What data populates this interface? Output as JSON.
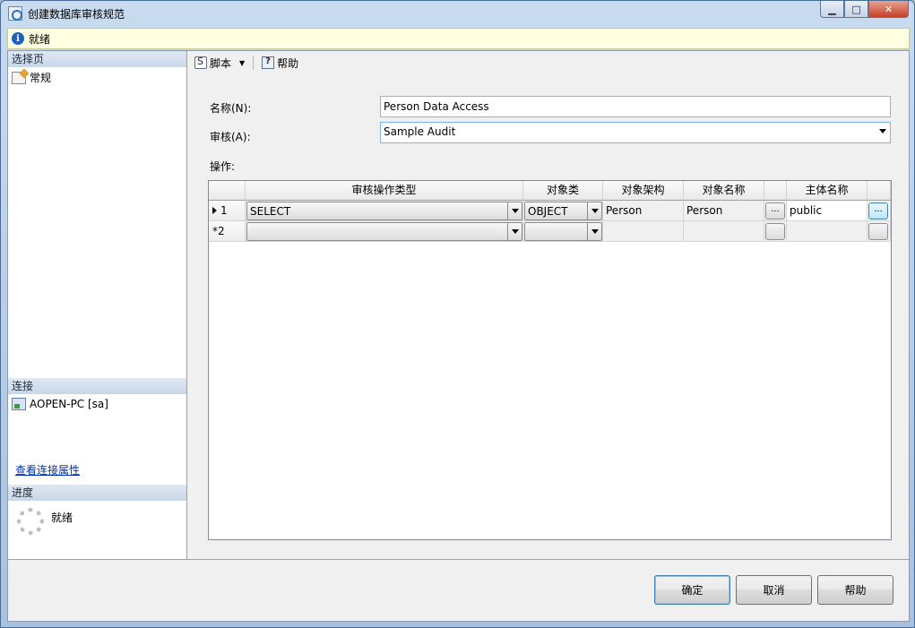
{
  "window": {
    "title": "创建数据库审核规范"
  },
  "infobar": {
    "status": "就绪"
  },
  "sidebar": {
    "select_page_header": "选择页",
    "pages": [
      {
        "label": "常规",
        "icon": "page-icon"
      }
    ],
    "connection_header": "连接",
    "connection_server": "AOPEN-PC [sa]",
    "view_connection_link": "查看连接属性",
    "progress_header": "进度",
    "progress_status": "就绪"
  },
  "toolbar": {
    "script_label": "脚本",
    "help_label": "帮助"
  },
  "form": {
    "name_label": "名称(N):",
    "name_value": "Person Data Access",
    "audit_label": "审核(A):",
    "audit_value": "Sample Audit",
    "actions_label": "操作:"
  },
  "grid": {
    "columns": [
      "审核操作类型",
      "对象类",
      "对象架构",
      "对象名称",
      "主体名称"
    ],
    "rows": [
      {
        "marker": "▶",
        "num": "1",
        "action_type": "SELECT",
        "object_class": "OBJECT",
        "schema": "Person",
        "object_name": "Person",
        "principal": "public"
      },
      {
        "marker": "*",
        "num": "2",
        "action_type": "",
        "object_class": "",
        "schema": "",
        "object_name": "",
        "principal": ""
      }
    ],
    "ellipsis": "..."
  },
  "buttons": {
    "ok": "确定",
    "cancel": "取消",
    "help": "帮助"
  }
}
